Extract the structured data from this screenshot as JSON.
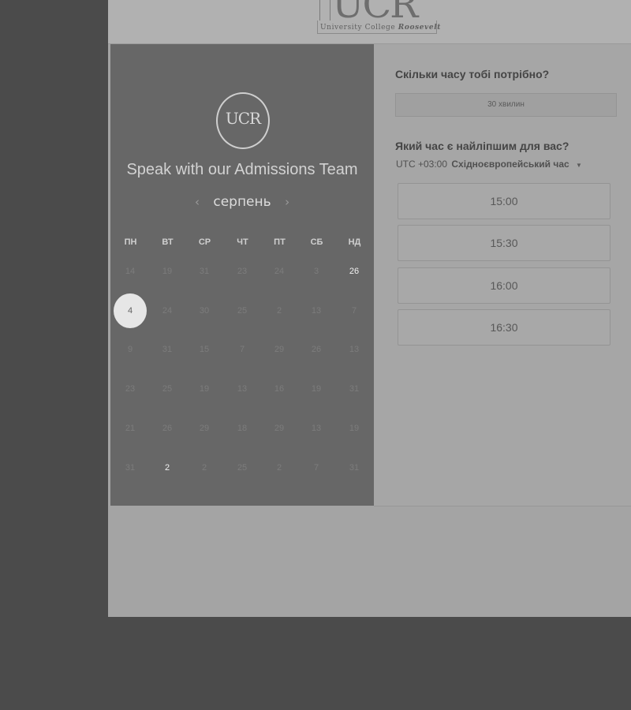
{
  "header": {
    "logo_text": "UCR",
    "logo_subtitle_plain": "University College ",
    "logo_subtitle_italic": "Roosevelt"
  },
  "event": {
    "logo_text": "UCR",
    "title": "Speak with our Admissions Team"
  },
  "calendar": {
    "month": "серпень",
    "prev_icon": "‹",
    "next_icon": "›",
    "weekdays": [
      "ПН",
      "ВТ",
      "СР",
      "ЧТ",
      "ПТ",
      "СБ",
      "НД"
    ],
    "weeks": [
      [
        {
          "label": "14"
        },
        {
          "label": "19"
        },
        {
          "label": "31"
        },
        {
          "label": "23"
        },
        {
          "label": "24"
        },
        {
          "label": "3"
        },
        {
          "label": "26",
          "active": true
        }
      ],
      [
        {
          "label": "4",
          "selected": true
        },
        {
          "label": "24"
        },
        {
          "label": "30"
        },
        {
          "label": "25"
        },
        {
          "label": "2"
        },
        {
          "label": "13"
        },
        {
          "label": "7"
        }
      ],
      [
        {
          "label": "9"
        },
        {
          "label": "31"
        },
        {
          "label": "15"
        },
        {
          "label": "7"
        },
        {
          "label": "29"
        },
        {
          "label": "26"
        },
        {
          "label": "13"
        }
      ],
      [
        {
          "label": "23"
        },
        {
          "label": "25"
        },
        {
          "label": "19"
        },
        {
          "label": "13"
        },
        {
          "label": "16"
        },
        {
          "label": "19"
        },
        {
          "label": "31"
        }
      ],
      [
        {
          "label": "21"
        },
        {
          "label": "26"
        },
        {
          "label": "29"
        },
        {
          "label": "18"
        },
        {
          "label": "29"
        },
        {
          "label": "13"
        },
        {
          "label": "19"
        }
      ],
      [
        {
          "label": "31"
        },
        {
          "label": "2",
          "active": true
        },
        {
          "label": "2"
        },
        {
          "label": "25"
        },
        {
          "label": "2"
        },
        {
          "label": "7"
        },
        {
          "label": "31"
        }
      ]
    ]
  },
  "booking": {
    "duration_question": "Скільки часу тобі потрібно?",
    "duration_option": "30 хвилин",
    "time_question": "Який час є найліпшим для вас?",
    "timezone_offset": "UTC +03:00",
    "timezone_name": "Східноєвропейський час",
    "timezone_chevron": "▼",
    "slots": [
      "15:00",
      "15:30",
      "16:00",
      "16:30"
    ]
  },
  "colors": {
    "overlay_bg": "#4b4b4b",
    "left_panel": "#676767",
    "right_panel": "#a6a6a6"
  }
}
